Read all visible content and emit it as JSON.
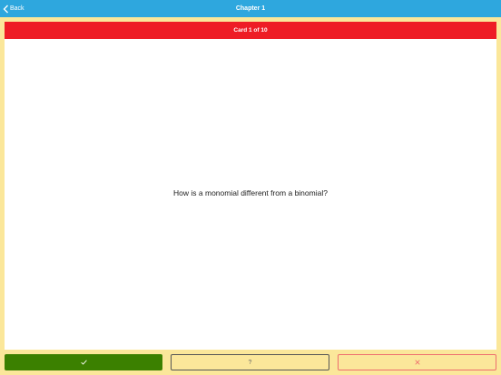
{
  "nav": {
    "back_label": "Back",
    "title": "Chapter 1"
  },
  "card": {
    "progress": "Card 1 of 10",
    "question": "How is a monomial different from a binomial?"
  },
  "actions": {
    "correct_icon": "checkmark-icon",
    "unsure_label": "?",
    "wrong_icon": "x-icon"
  },
  "colors": {
    "nav_bar": "#2ea7de",
    "card_header": "#ee1c25",
    "background": "#fbe79a",
    "correct_button": "#3b8000",
    "wrong_outline": "#ee6e6e"
  }
}
